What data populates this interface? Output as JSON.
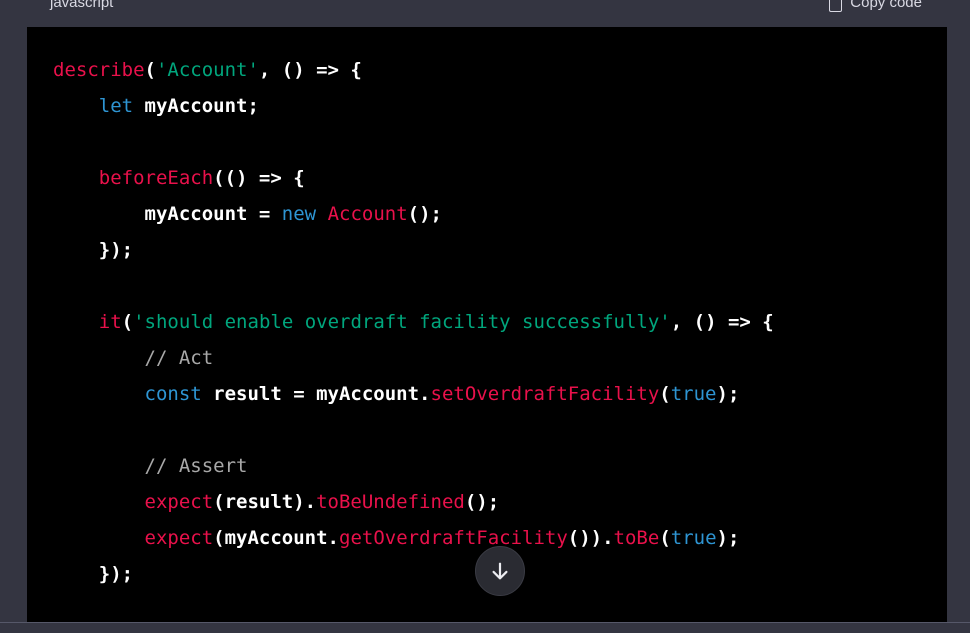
{
  "code_block": {
    "language": "javascript",
    "copy_label": "Copy code",
    "lines": [
      [
        {
          "t": "describe",
          "c": "fn"
        },
        {
          "t": "(",
          "c": "plain"
        },
        {
          "t": "'Account'",
          "c": "str"
        },
        {
          "t": ", () => {",
          "c": "plain"
        }
      ],
      [
        {
          "t": "    ",
          "c": "plain"
        },
        {
          "t": "let",
          "c": "kw"
        },
        {
          "t": " myAccount;",
          "c": "plain"
        }
      ],
      [],
      [
        {
          "t": "    ",
          "c": "plain"
        },
        {
          "t": "beforeEach",
          "c": "fn"
        },
        {
          "t": "(() => {",
          "c": "plain"
        }
      ],
      [
        {
          "t": "        myAccount = ",
          "c": "plain"
        },
        {
          "t": "new",
          "c": "kw"
        },
        {
          "t": " ",
          "c": "plain"
        },
        {
          "t": "Account",
          "c": "fn"
        },
        {
          "t": "();",
          "c": "plain"
        }
      ],
      [
        {
          "t": "    });",
          "c": "plain"
        }
      ],
      [],
      [
        {
          "t": "    ",
          "c": "plain"
        },
        {
          "t": "it",
          "c": "fn"
        },
        {
          "t": "(",
          "c": "plain"
        },
        {
          "t": "'should enable overdraft facility successfully'",
          "c": "str"
        },
        {
          "t": ", () => {",
          "c": "plain"
        }
      ],
      [
        {
          "t": "        ",
          "c": "plain"
        },
        {
          "t": "// Act",
          "c": "cm"
        }
      ],
      [
        {
          "t": "        ",
          "c": "plain"
        },
        {
          "t": "const",
          "c": "kw"
        },
        {
          "t": " result = myAccount.",
          "c": "plain"
        },
        {
          "t": "setOverdraftFacility",
          "c": "fn"
        },
        {
          "t": "(",
          "c": "plain"
        },
        {
          "t": "true",
          "c": "kw"
        },
        {
          "t": ");",
          "c": "plain"
        }
      ],
      [],
      [
        {
          "t": "        ",
          "c": "plain"
        },
        {
          "t": "// Assert",
          "c": "cm"
        }
      ],
      [
        {
          "t": "        ",
          "c": "plain"
        },
        {
          "t": "expect",
          "c": "fn"
        },
        {
          "t": "(result).",
          "c": "plain"
        },
        {
          "t": "toBeUndefined",
          "c": "fn"
        },
        {
          "t": "();",
          "c": "plain"
        }
      ],
      [
        {
          "t": "        ",
          "c": "plain"
        },
        {
          "t": "expect",
          "c": "fn"
        },
        {
          "t": "(myAccount.",
          "c": "plain"
        },
        {
          "t": "getOverdraftFacility",
          "c": "fn"
        },
        {
          "t": "()).",
          "c": "plain"
        },
        {
          "t": "toBe",
          "c": "fn"
        },
        {
          "t": "(",
          "c": "plain"
        },
        {
          "t": "true",
          "c": "kw"
        },
        {
          "t": ");",
          "c": "plain"
        }
      ],
      [
        {
          "t": "    });",
          "c": "plain"
        }
      ]
    ]
  },
  "scroll_button": {
    "icon": "arrow-down-icon"
  },
  "colors": {
    "page_background": "#343541",
    "code_background": "#000000",
    "function": "#e9114b",
    "string": "#00a67d",
    "keyword": "#2e95d3",
    "comment": "#a8a8a8",
    "plain": "#ffffff"
  }
}
